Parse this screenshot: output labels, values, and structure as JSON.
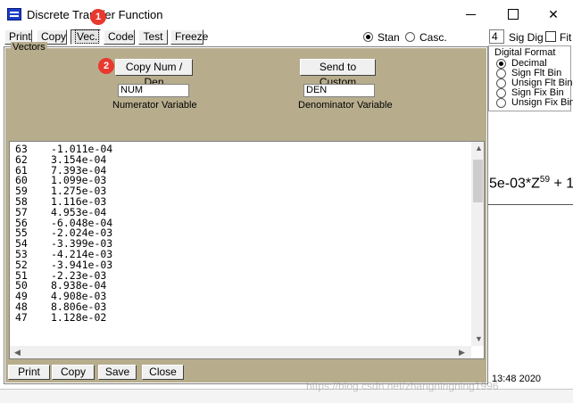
{
  "window": {
    "title": "Discrete Transfer Function"
  },
  "toolbar": {
    "buttons": [
      "Print",
      "Copy",
      "Vec.",
      "Code",
      "Test",
      "Freeze"
    ],
    "structure_options": [
      "Stan",
      "Casc."
    ],
    "structure_selected": "Stan",
    "sig_dig_value": "4",
    "sig_dig_label": "Sig Dig",
    "fit_label": "Fit"
  },
  "digital_format": {
    "title": "Digital Format",
    "options": [
      "Decimal",
      "Sign Flt Bin",
      "Unsign Flt Bin",
      "Sign Fix Bin",
      "Unsign Fix Bin"
    ],
    "selected": "Decimal"
  },
  "vectors": {
    "legend": "Vectors",
    "copy_button": "Copy Num / Den",
    "send_button": "Send to Custom",
    "num_value": "NUM",
    "num_caption": "Numerator Variable",
    "den_value": "DEN",
    "den_caption": "Denominator Variable",
    "rows": [
      {
        "index": "63",
        "value": "-1.011e-04"
      },
      {
        "index": "62",
        "value": "3.154e-04"
      },
      {
        "index": "61",
        "value": "7.393e-04"
      },
      {
        "index": "60",
        "value": "1.099e-03"
      },
      {
        "index": "59",
        "value": "1.275e-03"
      },
      {
        "index": "58",
        "value": "1.116e-03"
      },
      {
        "index": "57",
        "value": "4.953e-04"
      },
      {
        "index": "56",
        "value": "-6.048e-04"
      },
      {
        "index": "55",
        "value": "-2.024e-03"
      },
      {
        "index": "54",
        "value": "-3.399e-03"
      },
      {
        "index": "53",
        "value": "-4.214e-03"
      },
      {
        "index": "52",
        "value": "-3.941e-03"
      },
      {
        "index": "51",
        "value": "-2.23e-03"
      },
      {
        "index": "50",
        "value": "8.938e-04"
      },
      {
        "index": "49",
        "value": "4.908e-03"
      },
      {
        "index": "48",
        "value": "8.806e-03"
      },
      {
        "index": "47",
        "value": "1.128e-02"
      }
    ],
    "bottom_buttons": [
      "Print",
      "Copy",
      "Save",
      "Close"
    ]
  },
  "formula_fragment": "5e-03*Z",
  "formula_exponent": "59",
  "formula_tail": " + 1",
  "timestamp": "13:48 2020",
  "watermark": "https://blog.csdn.net/zhangningning1996",
  "annotations": [
    "1",
    "2"
  ],
  "colors": {
    "panel": "#b7ad8d",
    "badge": "#e8392f"
  }
}
